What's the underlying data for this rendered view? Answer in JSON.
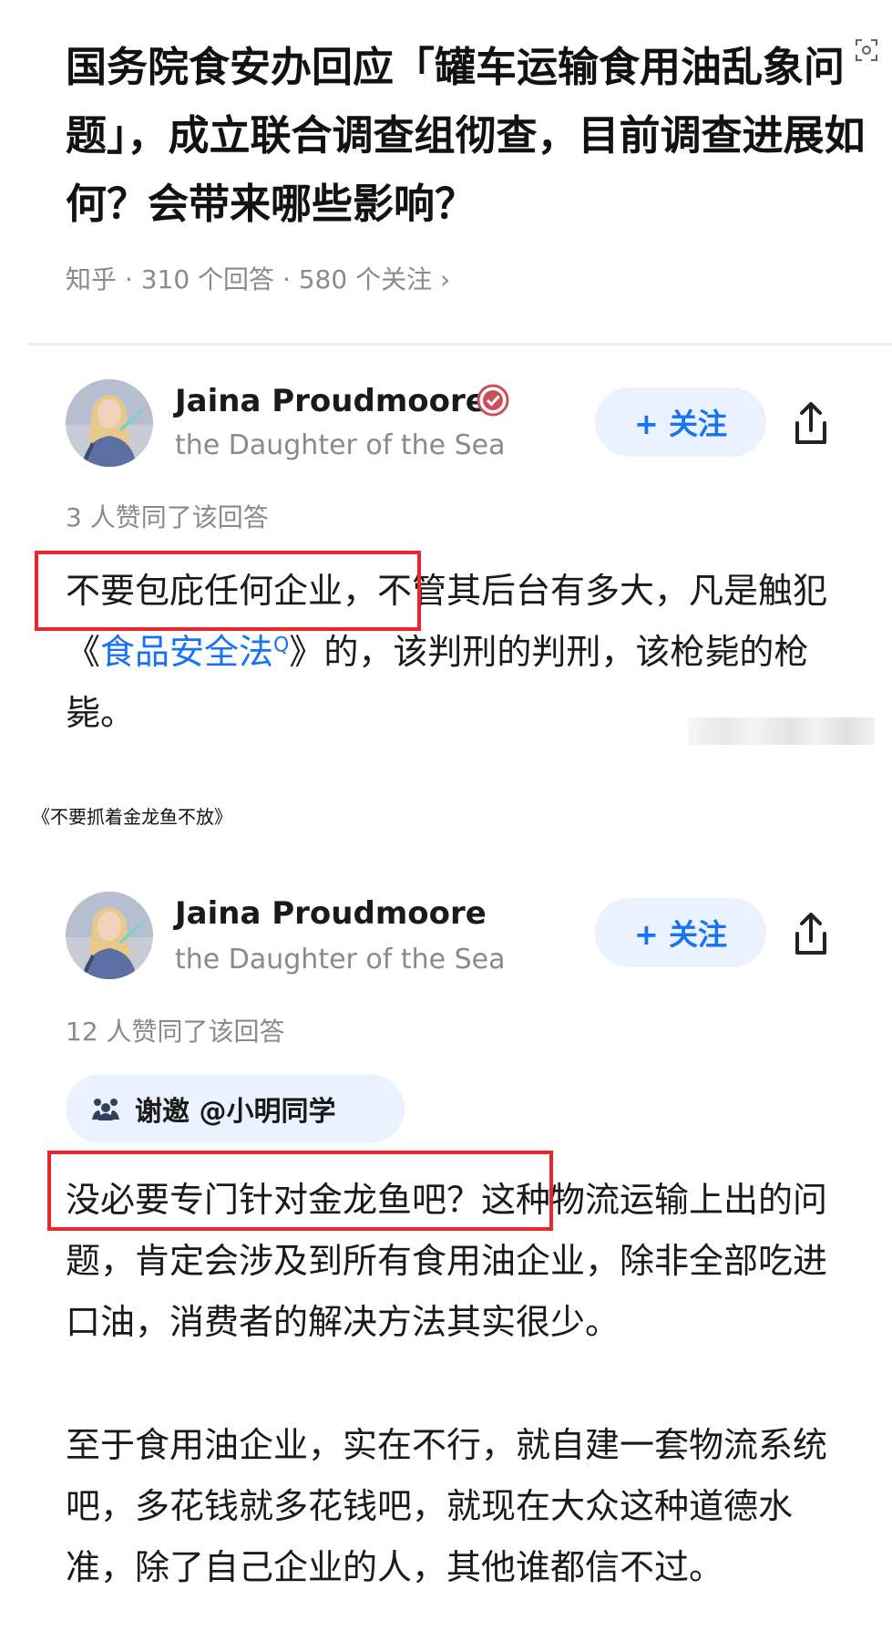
{
  "question": {
    "title": "国务院食安办回应「罐车运输食用油乱象问题」，成立联合调查组彻查，目前调查进展如何？会带来哪些影响？",
    "meta": "知乎 · 310 个回答 · 580 个关注 ›"
  },
  "answers": [
    {
      "author_name": "Jaina Proudmoore",
      "author_bio": "the Daughter of the Sea",
      "follow_label": "+ 关注",
      "likes": "3 人赞同了该回答",
      "text_highlight": "不要包庇任何企业，",
      "text_pre_link": "不管其后台有多大，凡是触犯《",
      "link_text": "食品安全法",
      "link_icon": "Q",
      "text_post_link": "》的，该判刑的判刑，该枪毙的枪毙。"
    },
    {
      "author_name": "Jaina Proudmoore",
      "author_bio": "the Daughter of the Sea",
      "follow_label": "+ 关注",
      "likes": "12 人赞同了该回答",
      "invite": "谢邀 @小明同学",
      "text_highlight": "没必要专门针对金龙鱼吧？",
      "text_rest": "这种物流运输上出的问题，肯定会涉及到所有食用油企业，除非全部吃进口油，消费者的解决方法其实很少。",
      "paragraph2": "至于食用油企业，实在不行，就自建一套物流系统吧，多花钱就多花钱吧，就现在大众这种道德水准，除了自己企业的人，其他谁都信不过。"
    }
  ],
  "caption": "《不要抓着金龙鱼不放》",
  "icons": {
    "scan": "scan-icon",
    "verified": "verified-badge-icon",
    "share": "share-icon",
    "invite": "invite-icon"
  },
  "colors": {
    "accent": "#1772f6",
    "highlight_border": "#e8262c",
    "follow_bg": "#eaf2ff",
    "badge": "#c8505a"
  }
}
